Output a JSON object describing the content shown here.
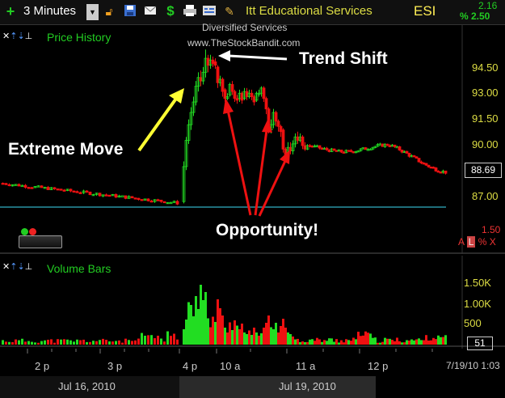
{
  "toolbar": {
    "interval": "3 Minutes",
    "company": "Itt Educational Services",
    "symbol": "ESI",
    "change": "2.16",
    "change_pct": "% 2.50",
    "icons": [
      "plus-icon",
      "dropdown-icon",
      "lock-icon",
      "save-icon",
      "mail-icon",
      "dollar-icon",
      "print-icon",
      "chart-settings-icon",
      "pencil-icon"
    ]
  },
  "price_panel": {
    "title": "Price History",
    "sector": "Diversified Services",
    "watermark": "www.TheStockBandit.com",
    "current_price": "88.69",
    "axis_labels": [
      "94.50",
      "93.00",
      "91.50",
      "90.00",
      "87.00"
    ],
    "bottom_value": "1.50",
    "bottom_controls": "A L % X"
  },
  "annotations": {
    "trend_shift": "Trend Shift",
    "extreme_move": "Extreme Move",
    "opportunity": "Opportunity!"
  },
  "volume_panel": {
    "title": "Volume Bars",
    "axis_labels": [
      "1.50K",
      "1.00K",
      "500"
    ],
    "current_value": "51"
  },
  "time_axis": {
    "ticks": [
      "2 p",
      "3 p",
      "4 p",
      "10 a",
      "11 a",
      "12 p"
    ],
    "dates": [
      "Jul 16, 2010",
      "Jul 19, 2010"
    ],
    "timestamp": "7/19/10 1:03"
  },
  "colors": {
    "up": "#22dd22",
    "down": "#ee1111",
    "panel_title": "#22cc22",
    "price_label": "#dddd44",
    "symbol": "#ffee55",
    "accent_red": "#ee3333"
  },
  "chart_data": {
    "type": "candlestick",
    "price": [
      {
        "x": "~1:50 p",
        "y": 87.9
      },
      {
        "x": "~2:30 p",
        "y": 87.6
      },
      {
        "x": "~3:00 p",
        "y": 87.4
      },
      {
        "x": "~3:40 p",
        "y": 86.9
      },
      {
        "x": "4:00 p close",
        "y": 86.8
      },
      {
        "x": "9:30 a open",
        "y": 90.2
      },
      {
        "x": "9:45 a",
        "y": 94.5
      },
      {
        "x": "10:00 a",
        "y": 94.9
      },
      {
        "x": "10:15 a",
        "y": 92.9
      },
      {
        "x": "10:30 a",
        "y": 93.1
      },
      {
        "x": "10:45 a",
        "y": 90.9
      },
      {
        "x": "11:00 a",
        "y": 90.2
      },
      {
        "x": "11:30 a",
        "y": 90.0
      },
      {
        "x": "12:00 p",
        "y": 89.9
      },
      {
        "x": "12:30 p",
        "y": 89.4
      },
      {
        "x": "1:03 p",
        "y": 88.69
      }
    ],
    "volume_peak": "~1.50K"
  }
}
